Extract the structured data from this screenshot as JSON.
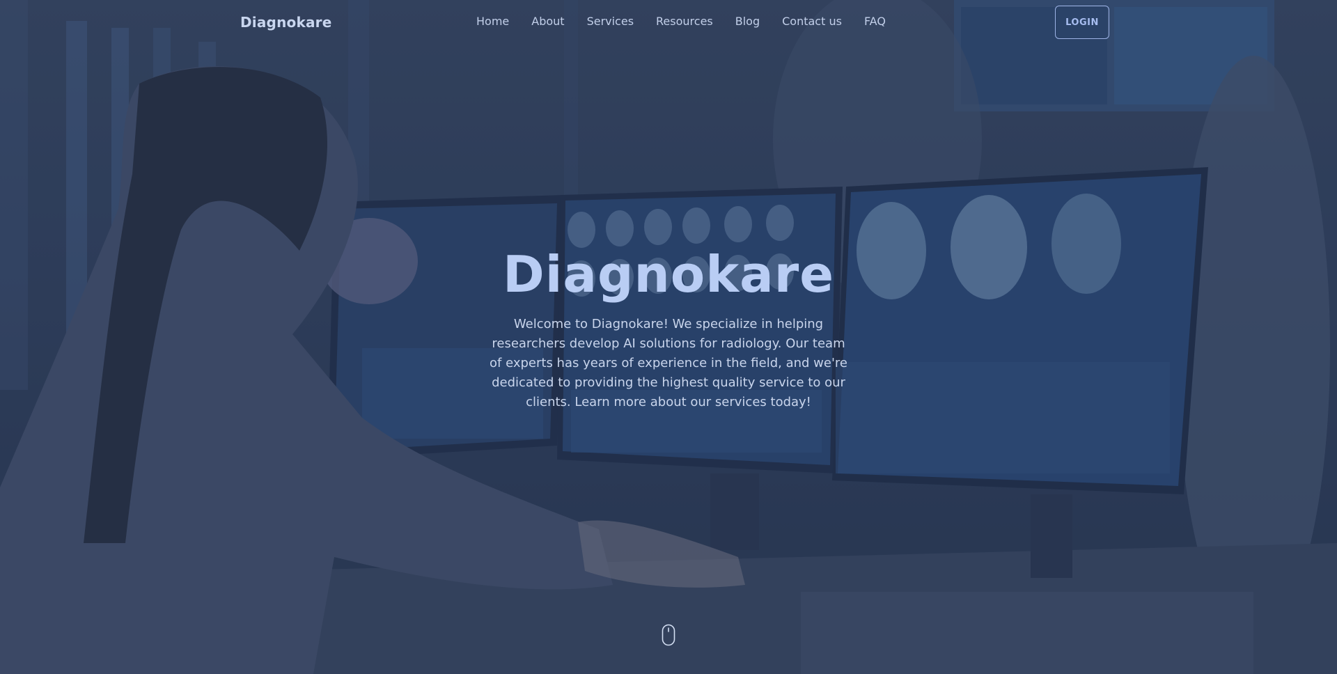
{
  "brand": "Diagnokare",
  "nav": {
    "items": [
      "Home",
      "About",
      "Services",
      "Resources",
      "Blog",
      "Contact us",
      "FAQ"
    ],
    "login_label": "LOGIN"
  },
  "hero": {
    "title": "Diagnokare",
    "description": "Welcome to Diagnokare! We specialize in helping researchers develop AI solutions for radiology. Our team of experts has years of experience in the field, and we're dedicated to providing the highest quality service to our clients. Learn more about our services today!",
    "scroll_icon": "mouse-scroll-icon"
  },
  "colors": {
    "overlay": "#263452",
    "accent": "#a7bdf0",
    "title": "#b9cdf4"
  }
}
